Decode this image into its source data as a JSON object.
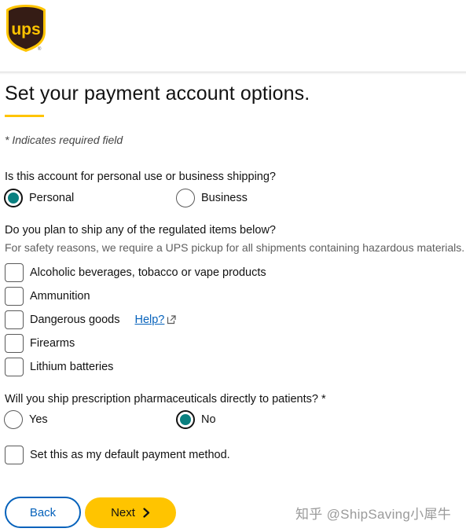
{
  "brand": {
    "logo_text": "UPS",
    "accent_color": "#ffc400",
    "brand_brown": "#351c15",
    "link_color": "#0662bb",
    "selected_color": "#0a8080"
  },
  "page": {
    "title": "Set your payment account options.",
    "required_note": "* Indicates required field"
  },
  "usage_question": {
    "label": "Is this account for personal use or business shipping?",
    "options": [
      {
        "label": "Personal",
        "selected": true
      },
      {
        "label": "Business",
        "selected": false
      }
    ]
  },
  "regulated_items": {
    "label": "Do you plan to ship any of the regulated items below?",
    "subtext": "For safety reasons, we require a UPS pickup for all shipments containing hazardous materials.",
    "items": [
      {
        "label": "Alcoholic beverages, tobacco or vape products",
        "checked": false
      },
      {
        "label": "Ammunition",
        "checked": false
      },
      {
        "label": "Dangerous goods",
        "checked": false,
        "help_link": "Help?"
      },
      {
        "label": "Firearms",
        "checked": false
      },
      {
        "label": "Lithium batteries",
        "checked": false
      }
    ]
  },
  "pharma_question": {
    "label": "Will you ship prescription pharmaceuticals directly to patients? *",
    "options": [
      {
        "label": "Yes",
        "selected": false
      },
      {
        "label": "No",
        "selected": true
      }
    ]
  },
  "default_payment": {
    "label": "Set this as my default payment method.",
    "checked": false
  },
  "buttons": {
    "back_label": "Back",
    "next_label": "Next"
  },
  "watermark": "知乎 @ShipSaving小犀牛"
}
